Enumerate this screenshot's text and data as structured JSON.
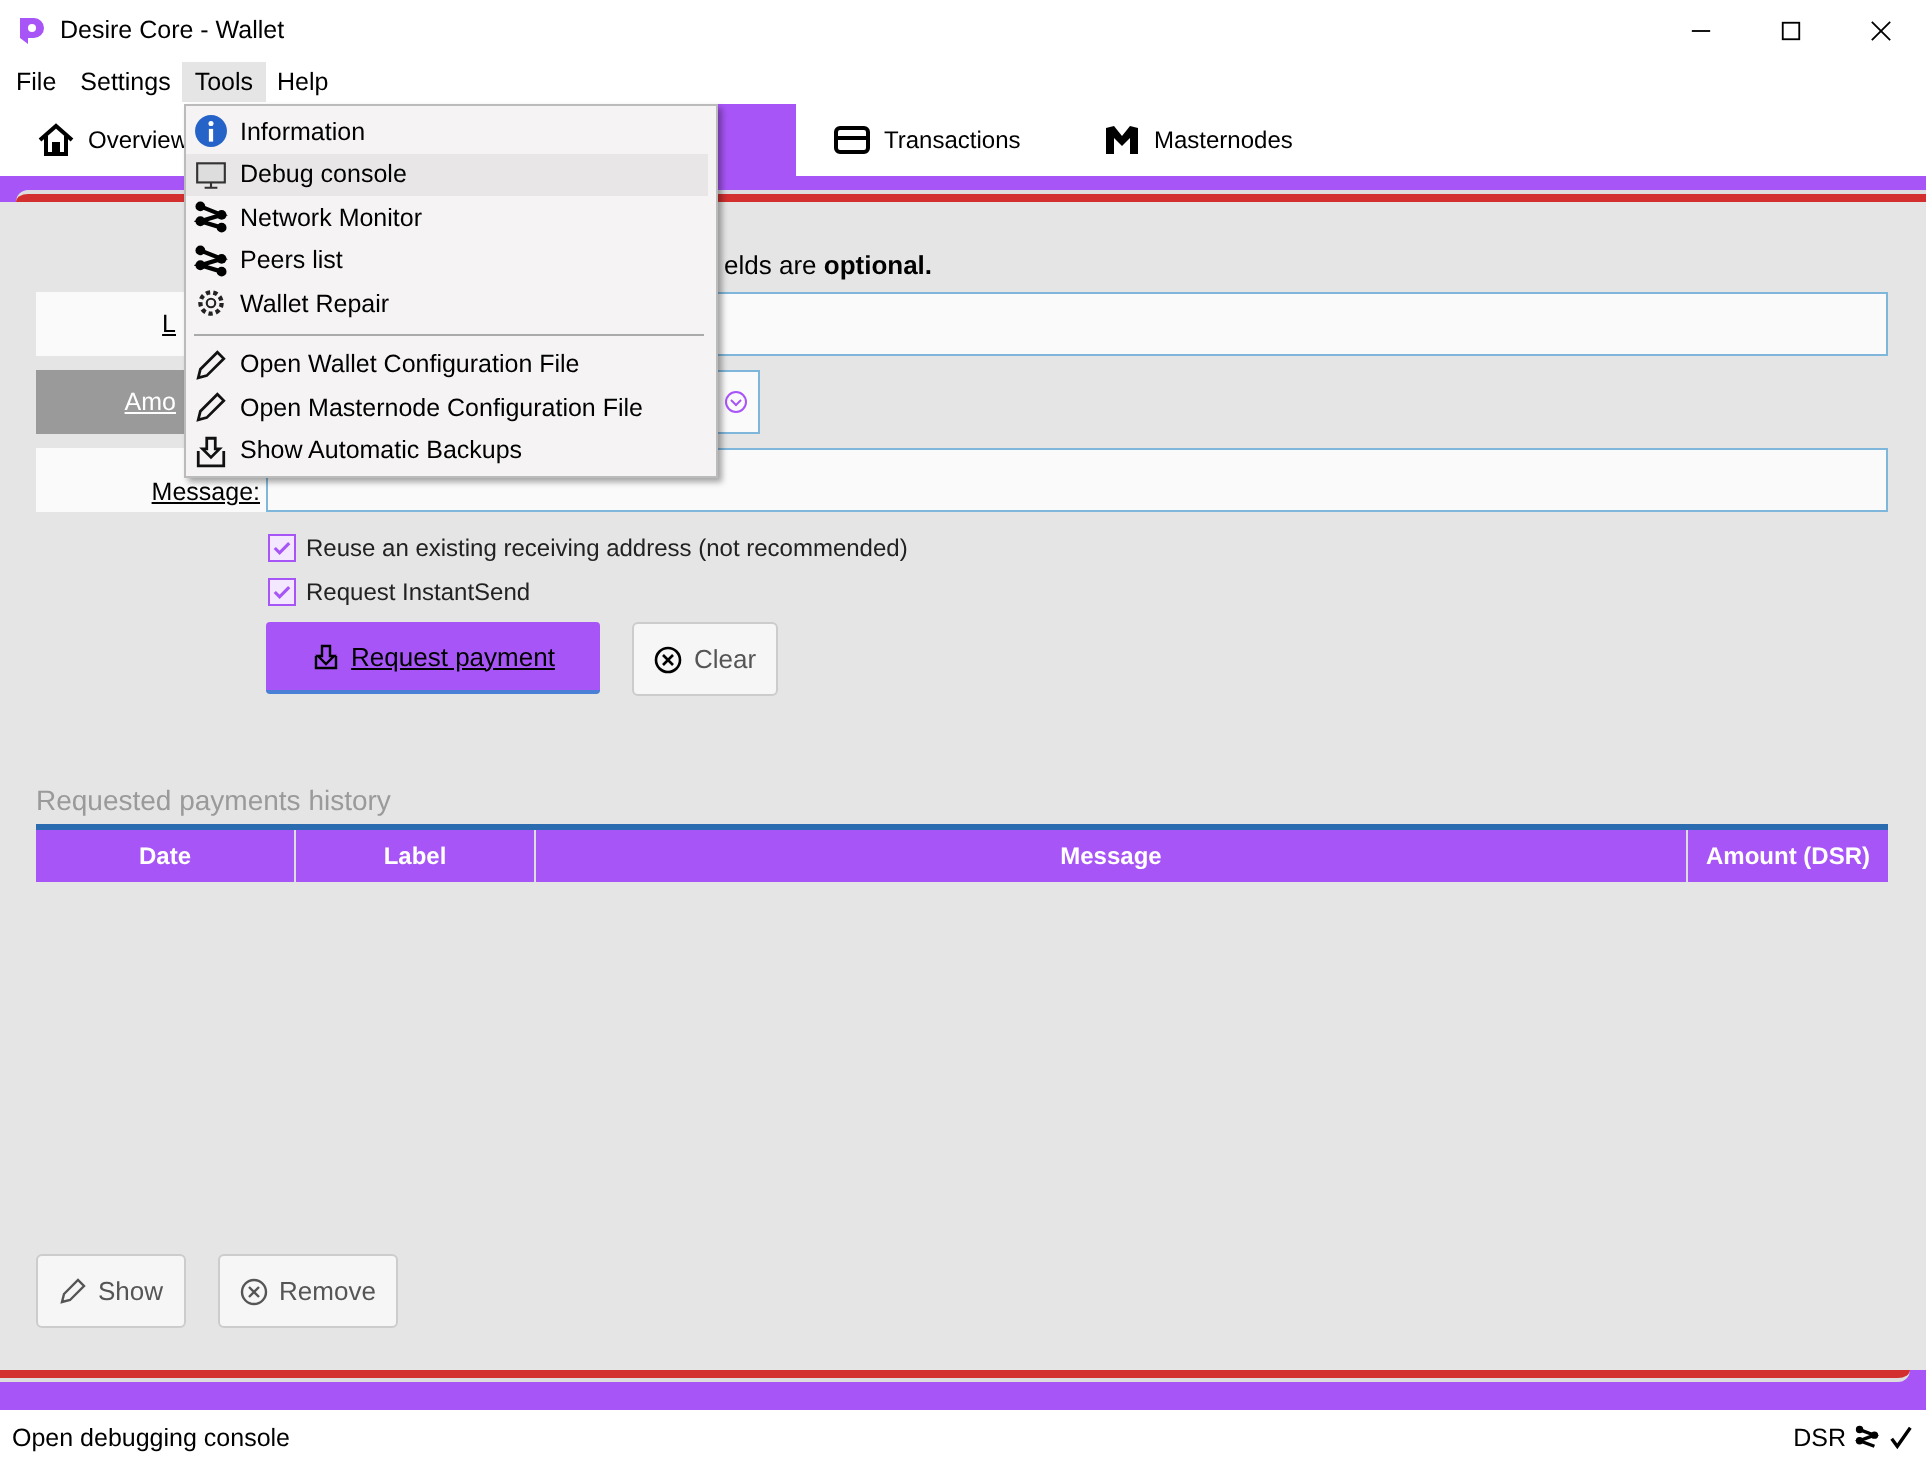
{
  "window": {
    "title": "Desire Core - Wallet"
  },
  "menubar": [
    {
      "label": "File",
      "selected": false
    },
    {
      "label": "Settings",
      "selected": false
    },
    {
      "label": "Tools",
      "selected": true
    },
    {
      "label": "Help",
      "selected": false
    }
  ],
  "tabs": [
    {
      "label": "Overview",
      "selected": false
    },
    {
      "selected": true
    },
    {
      "label": "Transactions",
      "selected": false
    },
    {
      "label": "Masternodes",
      "selected": false
    }
  ],
  "form": {
    "intro": "elds are **optional.**",
    "fields": [
      {
        "label": "L",
        "kind": "text",
        "selected": false
      },
      {
        "label": "Amo",
        "kind": "amount",
        "selected": true
      },
      {
        "label": "Message:",
        "kind": "text",
        "selected": false
      }
    ],
    "checks": [
      {
        "label": "Reuse an existing receiving address (not recommended)",
        "checked": true
      },
      {
        "label": "Request InstantSend",
        "checked": true
      }
    ],
    "request_button": "Request payment",
    "clear_button": "Clear"
  },
  "history": {
    "title": "Requested payments history",
    "columns": [
      "Date",
      "Label",
      "Message",
      "Amount (DSR)"
    ]
  },
  "bottom_buttons": [
    "Show",
    "Remove"
  ],
  "tools_menu": [
    {
      "label": "Information",
      "selected": false
    },
    {
      "label": "Debug console",
      "selected": true
    },
    {
      "label": "Network Monitor",
      "selected": false
    },
    {
      "label": "Peers list",
      "selected": false
    },
    {
      "label": "Wallet Repair",
      "selected": false
    },
    {
      "kind": "separator"
    },
    {
      "label": "Open Wallet Configuration File",
      "selected": false
    },
    {
      "label": "Open Masternode Configuration File",
      "selected": false
    },
    {
      "label": "Show Automatic Backups",
      "selected": false
    }
  ],
  "status_bar": {
    "text": "Open debugging console",
    "unit": "DSR"
  }
}
